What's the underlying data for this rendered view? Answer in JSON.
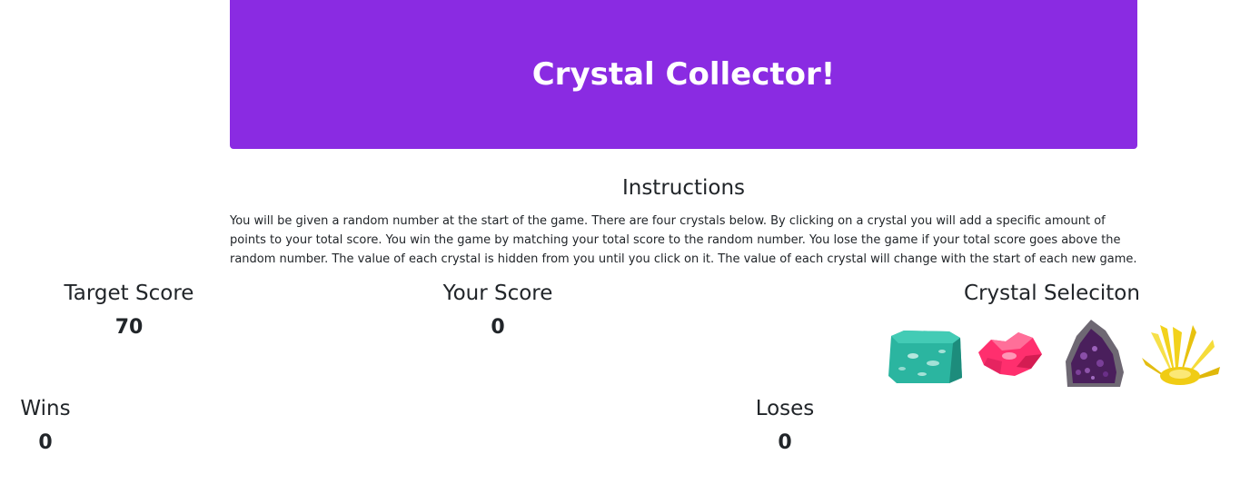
{
  "header": {
    "title": "Crystal Collector!"
  },
  "instructions": {
    "title": "Instructions",
    "text": "You will be given a random number at the start of the game. There are four crystals below. By clicking on a crystal you will add a specific amount of points to your total score. You win the game by matching your total score to the random number. You lose the game if your total score goes above the random number. The value of each crystal is hidden from you until you click on it. The value of each crystal will change with the start of each new game."
  },
  "target": {
    "label": "Target Score",
    "value": "70"
  },
  "score": {
    "label": "Your Score",
    "value": "0"
  },
  "crystals": {
    "label": "Crystal Seleciton",
    "items": [
      {
        "icon": "teal-crystal-icon",
        "color": "#2bb5a0"
      },
      {
        "icon": "pink-crystal-icon",
        "color": "#ff2f6e"
      },
      {
        "icon": "purple-amethyst-icon",
        "color": "#5b2a6e"
      },
      {
        "icon": "yellow-crystal-icon",
        "color": "#f2d21c"
      }
    ]
  },
  "wins": {
    "label": "Wins",
    "value": "0"
  },
  "losses": {
    "label": "Loses",
    "value": "0"
  },
  "colors": {
    "accent": "#8a2be2",
    "text": "#212529"
  }
}
